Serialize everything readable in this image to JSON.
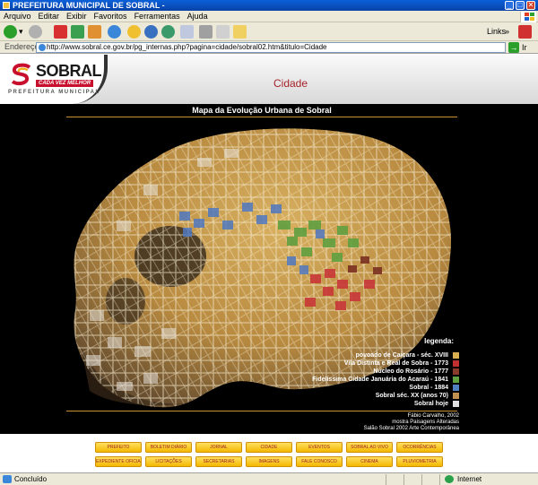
{
  "window": {
    "title": "PREFEITURA MUNICIPAL DE SOBRAL -",
    "controls": [
      "_",
      "□",
      "✕"
    ]
  },
  "menu": [
    "Arquivo",
    "Editar",
    "Exibir",
    "Favoritos",
    "Ferramentas",
    "Ajuda"
  ],
  "toolbar": {
    "icons": [
      "back-icon",
      "forward-icon",
      "stop-icon",
      "refresh-icon",
      "home-icon",
      "search-icon",
      "favorites-icon",
      "history-icon",
      "mail-icon",
      "print-icon",
      "edit-icon",
      "discuss-icon"
    ],
    "links_label": "Links",
    "chevron": "»"
  },
  "address": {
    "label": "Endereço",
    "url": "http://www.sobral.ce.gov.br/pg_internas.php?pagina=cidade/sobral02.htm&titulo=Cidade",
    "go_label": "Ir"
  },
  "site": {
    "logo_name": "SOBRAL",
    "logo_tagline": "CADA VEZ MELHOR",
    "logo_sub": "PREFEITURA MUNICIPAL",
    "page_heading": "Cidade"
  },
  "map": {
    "title": "Mapa da Evolução Urbana de Sobral",
    "legend_title": "legenda:",
    "legend": [
      {
        "label": "povoado de Caiçara - séc. XVIII",
        "color": "#d8b050"
      },
      {
        "label": "Vila Distinta e Real de Sobra - 1773",
        "color": "#c03030"
      },
      {
        "label": "Núcleo do Rosário - 1777",
        "color": "#8a3a2a"
      },
      {
        "label": "Fidelíssima Cidade Januária do Acaraú - 1841",
        "color": "#60a040"
      },
      {
        "label": "Sobral - 1884",
        "color": "#5080c0"
      },
      {
        "label": "Sobral séc. XX (anos 70)",
        "color": "#c09050"
      },
      {
        "label": "Sobral hoje",
        "color": "#e0e0e0"
      }
    ],
    "credits": [
      "Fábio Carvalho, 2002",
      "mostra Paisagens Alteradas",
      "Salão Sobral 2002 Arte Contemporânea"
    ]
  },
  "nav": {
    "row1": [
      "PREFEITO",
      "BOLETIM DIÁRIO",
      "JORNAL",
      "CIDADE",
      "EVENTOS",
      "SOBRAL AO VIVO",
      "OCORRÊNCIAS"
    ],
    "row2": [
      "EXPEDIENTE OFICIAL",
      "LICITAÇÕES",
      "SECRETARIAS",
      "IMAGENS",
      "FALE CONOSCO",
      "CINEMA",
      "PLUVIOMETRIA"
    ]
  },
  "status": {
    "text": "Concluído",
    "zone": "Internet"
  },
  "colors": {
    "accent_red": "#a6222a",
    "nav_yellow": "#f3b800",
    "title_blue": "#0a5fd8"
  }
}
